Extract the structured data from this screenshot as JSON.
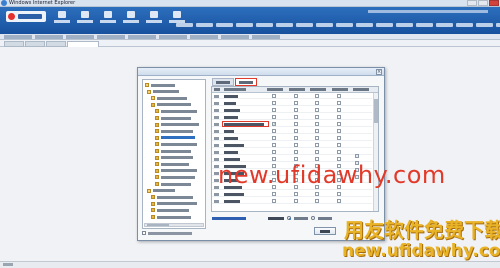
{
  "window": {
    "title": "Windows Internet Explorer"
  },
  "header": {
    "top_menu": [
      {
        "label": "",
        "icon": "grid-icon"
      },
      {
        "label": "",
        "icon": "list-icon"
      },
      {
        "label": "",
        "icon": "chart-icon"
      },
      {
        "label": "",
        "icon": "doc-icon"
      },
      {
        "label": "",
        "icon": "report-icon"
      },
      {
        "label": "",
        "icon": "setting-icon"
      }
    ],
    "right_menu": [
      "",
      "",
      "",
      "",
      "",
      "",
      "",
      "",
      "",
      "",
      "",
      "",
      "",
      "",
      "",
      "",
      ""
    ],
    "user_info": ""
  },
  "module_row": {
    "tabs": [
      "",
      "",
      "",
      "",
      "",
      "",
      "",
      "",
      ""
    ]
  },
  "page_tabs": {
    "tabs": [
      "",
      "",
      "",
      ""
    ]
  },
  "status_bar": {
    "text": ""
  },
  "dialog": {
    "title": "",
    "close_label": "×",
    "tree": {
      "items": [
        "",
        "",
        "",
        "",
        "",
        "",
        "",
        "",
        "",
        "",
        "",
        "",
        "",
        "",
        "",
        "",
        "",
        "",
        "",
        "",
        ""
      ]
    },
    "tree_checkbox_label": "",
    "tabs": [
      {
        "label": "",
        "active": false
      },
      {
        "label": "",
        "active": true
      }
    ],
    "grid": {
      "columns": [
        "",
        "",
        "",
        "",
        "",
        "",
        ""
      ],
      "rows": [
        {
          "num": "",
          "name": "",
          "checks": [
            false,
            false,
            false,
            false
          ]
        },
        {
          "num": "",
          "name": "",
          "checks": [
            false,
            false,
            false,
            false
          ]
        },
        {
          "num": "",
          "name": "",
          "checks": [
            false,
            false,
            false,
            false
          ]
        },
        {
          "num": "",
          "name": "",
          "checks": [
            false,
            false,
            false,
            false
          ]
        },
        {
          "num": "",
          "name": "",
          "checks": [
            true,
            false,
            false,
            false
          ],
          "highlight": true
        },
        {
          "num": "",
          "name": "",
          "checks": [
            false,
            false,
            false,
            false
          ]
        },
        {
          "num": "",
          "name": "",
          "checks": [
            false,
            false,
            false,
            false
          ]
        },
        {
          "num": "",
          "name": "",
          "checks": [
            false,
            false,
            false,
            false
          ]
        },
        {
          "num": "",
          "name": "",
          "checks": [
            false,
            false,
            false,
            false
          ]
        },
        {
          "num": "",
          "name": "",
          "checks": [
            false,
            false,
            false,
            false
          ]
        },
        {
          "num": "",
          "name": "",
          "checks": [
            false,
            false,
            false,
            false
          ]
        },
        {
          "num": "",
          "name": "",
          "checks": [
            false,
            false,
            false,
            false
          ]
        },
        {
          "num": "",
          "name": "",
          "checks": [
            false,
            false,
            false,
            false
          ]
        },
        {
          "num": "",
          "name": "",
          "checks": [
            false,
            false,
            false,
            false
          ]
        },
        {
          "num": "",
          "name": "",
          "checks": [
            false,
            false,
            false,
            false
          ]
        },
        {
          "num": "",
          "name": "",
          "checks": [
            false,
            false,
            false,
            false
          ]
        }
      ]
    },
    "link_label": "",
    "mode_label": "",
    "mode_options": [
      {
        "label": "",
        "checked": true
      },
      {
        "label": "",
        "checked": false
      }
    ],
    "ok_label": "",
    "cancel_label": ""
  },
  "watermarks": {
    "url_top": "new.ufidawhy.com",
    "brand_cn": "用友软件免费下载",
    "url_bottom": "new.ufidawhy.com"
  },
  "colors": {
    "header_blue": "#1f5ea8",
    "highlight_red": "#e03a2c",
    "watermark_red": "#e23a2a",
    "watermark_gold": "#e8b326"
  }
}
